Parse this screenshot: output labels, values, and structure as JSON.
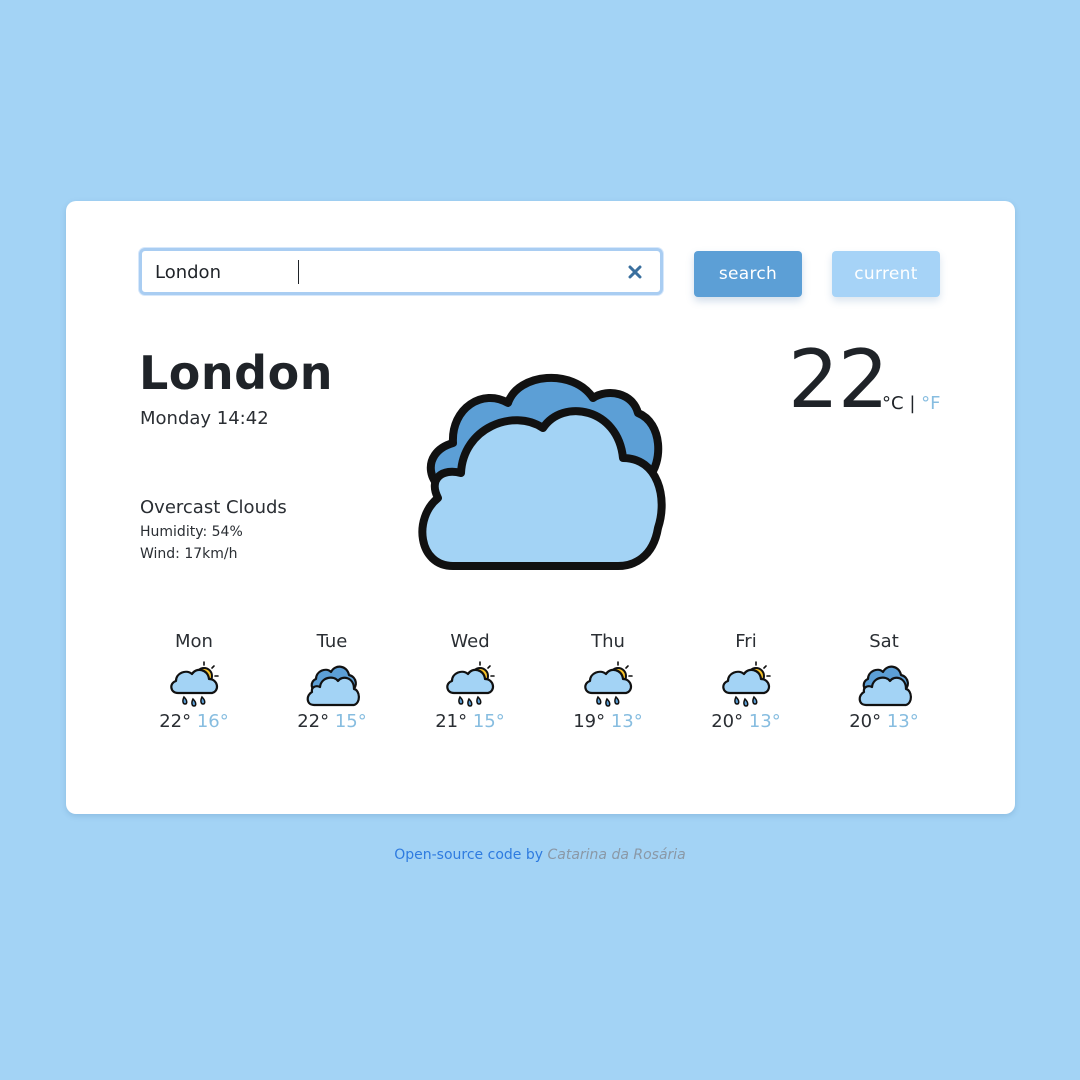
{
  "search": {
    "value": "London",
    "search_label": "search",
    "current_label": "current"
  },
  "weather": {
    "city": "London",
    "datetime": "Monday 14:42",
    "description": "Overcast Clouds",
    "humidity": "Humidity: 54%",
    "wind": "Wind: 17km/h",
    "temperature": "22",
    "unit_celsius": "°C",
    "unit_separator": "|",
    "unit_fahrenheit": "°F",
    "icon": "overcast-clouds-icon"
  },
  "forecast": [
    {
      "day": "Mon",
      "max": "22°",
      "min": "16°",
      "icon": "rain-sun-icon"
    },
    {
      "day": "Tue",
      "max": "22°",
      "min": "15°",
      "icon": "cloud-icon"
    },
    {
      "day": "Wed",
      "max": "21°",
      "min": "15°",
      "icon": "rain-sun-icon"
    },
    {
      "day": "Thu",
      "max": "19°",
      "min": "13°",
      "icon": "rain-sun-icon"
    },
    {
      "day": "Fri",
      "max": "20°",
      "min": "13°",
      "icon": "rain-sun-icon"
    },
    {
      "day": "Sat",
      "max": "20°",
      "min": "13°",
      "icon": "cloud-icon"
    }
  ],
  "footer": {
    "text": "Open-source code by",
    "author": "Catarina da Rosária"
  },
  "colors": {
    "background": "#a3d3f5",
    "search_button": "#5c9fd6",
    "current_button": "#a6d3f7",
    "min_temp": "#87bde0",
    "link": "#2e7be0"
  }
}
